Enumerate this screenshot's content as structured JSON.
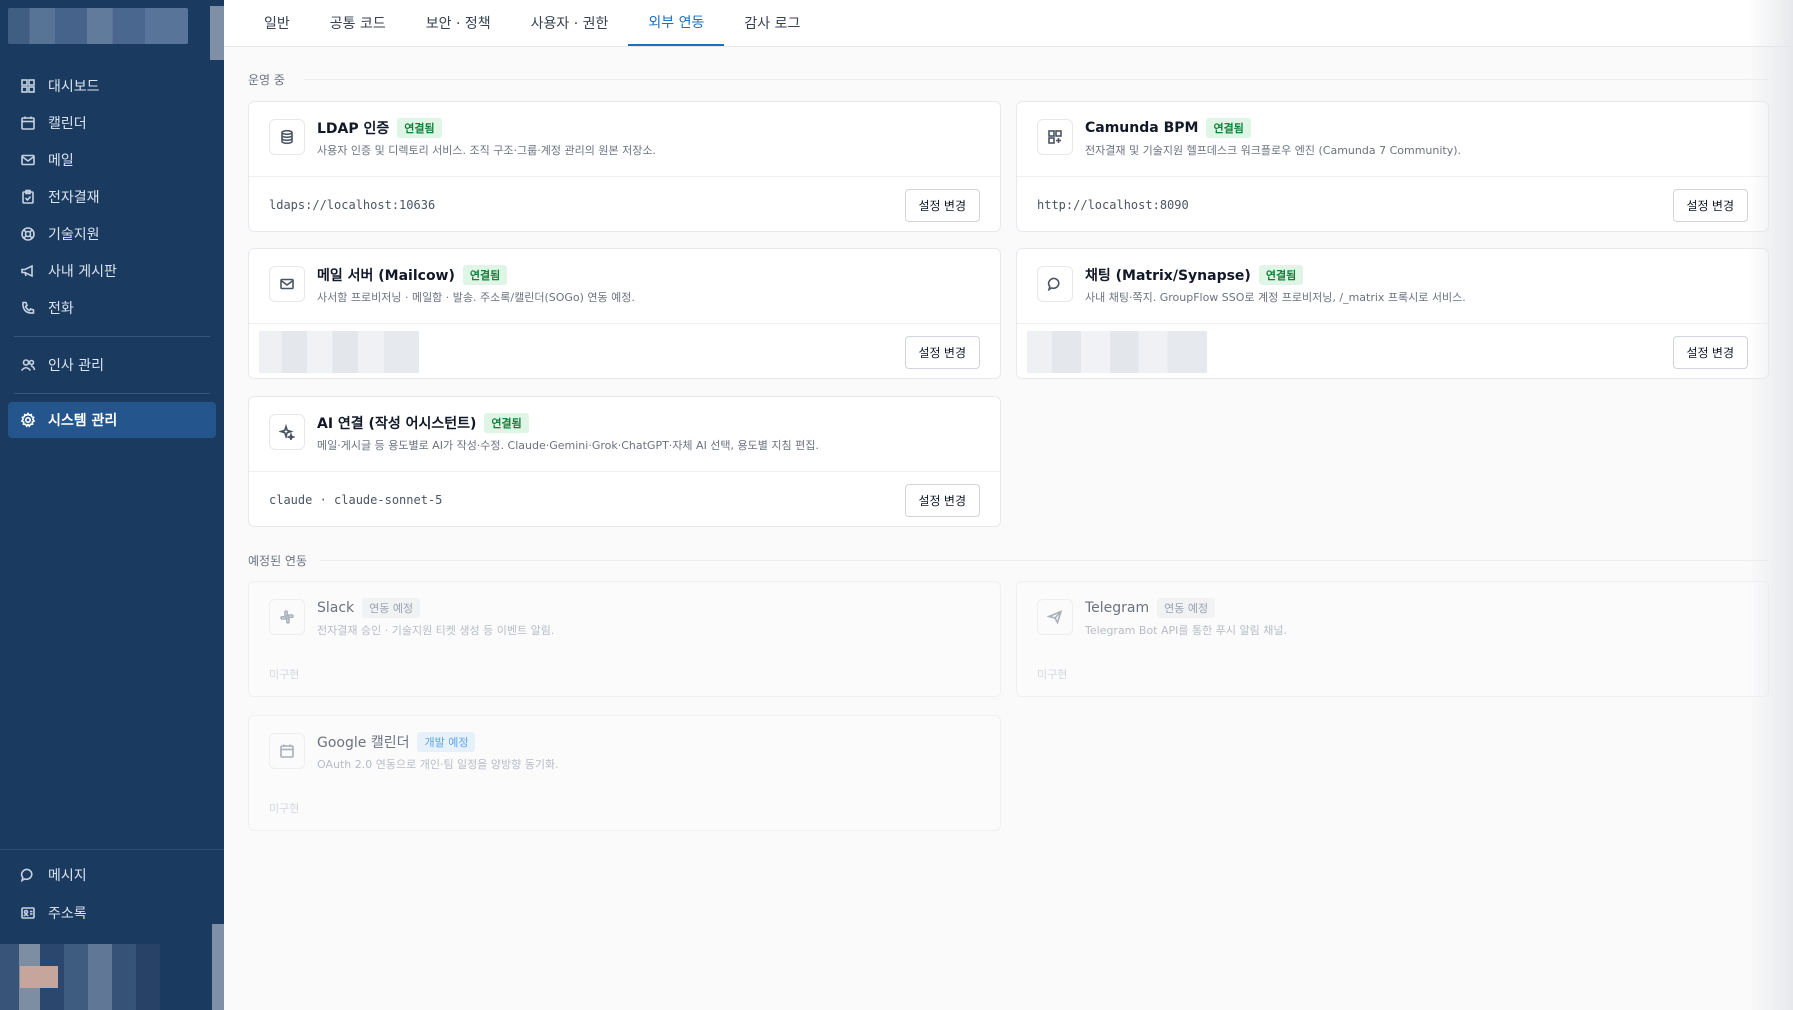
{
  "sidebar": {
    "nav": [
      {
        "label": "대시보드",
        "icon": "dashboard-icon"
      },
      {
        "label": "캘린더",
        "icon": "calendar-icon"
      },
      {
        "label": "메일",
        "icon": "mail-icon"
      },
      {
        "label": "전자결재",
        "icon": "clipboard-icon"
      },
      {
        "label": "기술지원",
        "icon": "lifebuoy-icon"
      },
      {
        "label": "사내 게시판",
        "icon": "megaphone-icon"
      },
      {
        "label": "전화",
        "icon": "phone-icon"
      }
    ],
    "hr": {
      "label": "인사 관리",
      "icon": "users-icon"
    },
    "system": {
      "label": "시스템 관리",
      "icon": "gear-icon"
    },
    "bottom": [
      {
        "label": "메시지",
        "icon": "chat-icon"
      },
      {
        "label": "주소록",
        "icon": "contact-card-icon"
      }
    ]
  },
  "tabs": [
    {
      "label": "일반",
      "active": false
    },
    {
      "label": "공통 코드",
      "active": false
    },
    {
      "label": "보안 · 정책",
      "active": false
    },
    {
      "label": "사용자 · 권한",
      "active": false
    },
    {
      "label": "외부 연동",
      "active": true
    },
    {
      "label": "감사 로그",
      "active": false
    }
  ],
  "sections": {
    "active_title": "운영 중",
    "planned_title": "예정된 연동"
  },
  "active_cards": [
    {
      "title": "LDAP 인증",
      "badge": "연결됨",
      "desc": "사용자 인증 및 디렉토리 서비스. 조직 구조·그룹·계정 관리의 원본 저장소.",
      "endpoint": "ldaps://localhost:10636",
      "button": "설정 변경",
      "icon": "database-icon"
    },
    {
      "title": "Camunda BPM",
      "badge": "연결됨",
      "desc": "전자결재 및 기술지원 헬프데스크 워크플로우 엔진 (Camunda 7 Community).",
      "endpoint": "http://localhost:8090",
      "button": "설정 변경",
      "icon": "workflow-icon"
    },
    {
      "title": "메일 서버 (Mailcow)",
      "badge": "연결됨",
      "desc": "사서함 프로비저닝 · 메일함 · 발송. 주소록/캘린더(SOGo) 연동 예정.",
      "endpoint": "",
      "button": "설정 변경",
      "icon": "mail-icon"
    },
    {
      "title": "채팅 (Matrix/Synapse)",
      "badge": "연결됨",
      "desc": "사내 채팅·쪽지. GroupFlow SSO로 계정 프로비저닝, /_matrix 프록시로 서비스.",
      "endpoint": "",
      "button": "설정 변경",
      "icon": "chat-icon"
    },
    {
      "title": "AI 연결 (작성 어시스턴트)",
      "badge": "연결됨",
      "desc": "메일·게시글 등 용도별로 AI가 작성·수정. Claude·Gemini·Grok·ChatGPT·자체 AI 선택, 용도별 지침 편집.",
      "endpoint": "claude · claude-sonnet-5",
      "button": "설정 변경",
      "icon": "sparkle-icon"
    }
  ],
  "planned_cards": [
    {
      "title": "Slack",
      "badge": "연동 예정",
      "desc": "전자결재 승인 · 기술지원 티켓 생성 등 이벤트 알림.",
      "status": "미구현",
      "icon": "slack-icon"
    },
    {
      "title": "Telegram",
      "badge": "연동 예정",
      "desc": "Telegram Bot API를 통한 푸시 알림 채널.",
      "status": "미구현",
      "icon": "send-icon"
    },
    {
      "title": "Google 캘린더",
      "badge": "개발 예정",
      "desc": "OAuth 2.0 연동으로 개인·팀 일정을 양방향 동기화.",
      "status": "미구현",
      "icon": "calendar-icon"
    }
  ]
}
